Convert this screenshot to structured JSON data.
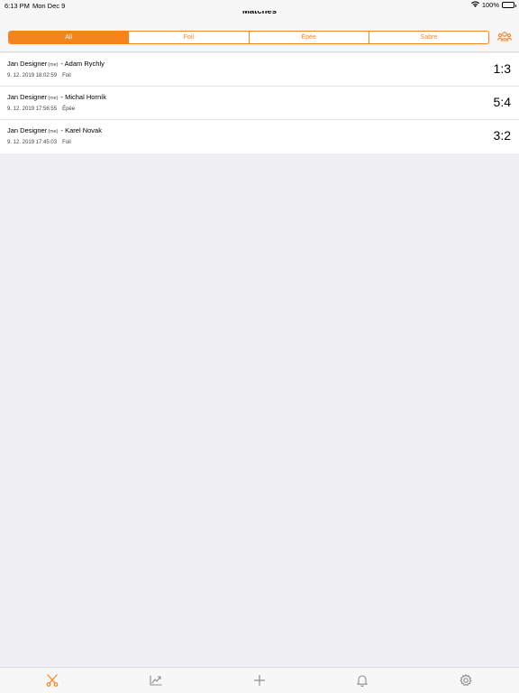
{
  "status_bar": {
    "time": "6:13 PM",
    "date": "Mon Dec 9",
    "battery": "100%"
  },
  "nav": {
    "title": "Matches"
  },
  "filter": {
    "segments": [
      {
        "label": "All",
        "active": true
      },
      {
        "label": "Foil",
        "active": false
      },
      {
        "label": "Épée",
        "active": false
      },
      {
        "label": "Sabre",
        "active": false
      }
    ]
  },
  "matches": [
    {
      "player": "Jan Designer",
      "me_tag": "(me)",
      "opponent": "- Adam Rychly",
      "datetime": "9. 12. 2019 18:02:59",
      "weapon": "Foil",
      "score": "1:3"
    },
    {
      "player": "Jan Designer",
      "me_tag": "(me)",
      "opponent": "- Michal Horník",
      "datetime": "9. 12. 2019 17:56:55",
      "weapon": "Épée",
      "score": "5:4"
    },
    {
      "player": "Jan Designer",
      "me_tag": "(me)",
      "opponent": "- Karel Novak",
      "datetime": "9. 12. 2019 17:45:03",
      "weapon": "Foil",
      "score": "3:2"
    }
  ],
  "tab_bar": {
    "tabs": [
      {
        "icon": "crossed-swords-icon",
        "active": true
      },
      {
        "icon": "chart-icon",
        "active": false
      },
      {
        "icon": "plus-icon",
        "active": false
      },
      {
        "icon": "bell-icon",
        "active": false
      },
      {
        "icon": "gear-icon",
        "active": false
      }
    ]
  },
  "colors": {
    "accent": "#f5841f",
    "inactive_icon": "#8e8e93",
    "background": "#efeff4"
  }
}
